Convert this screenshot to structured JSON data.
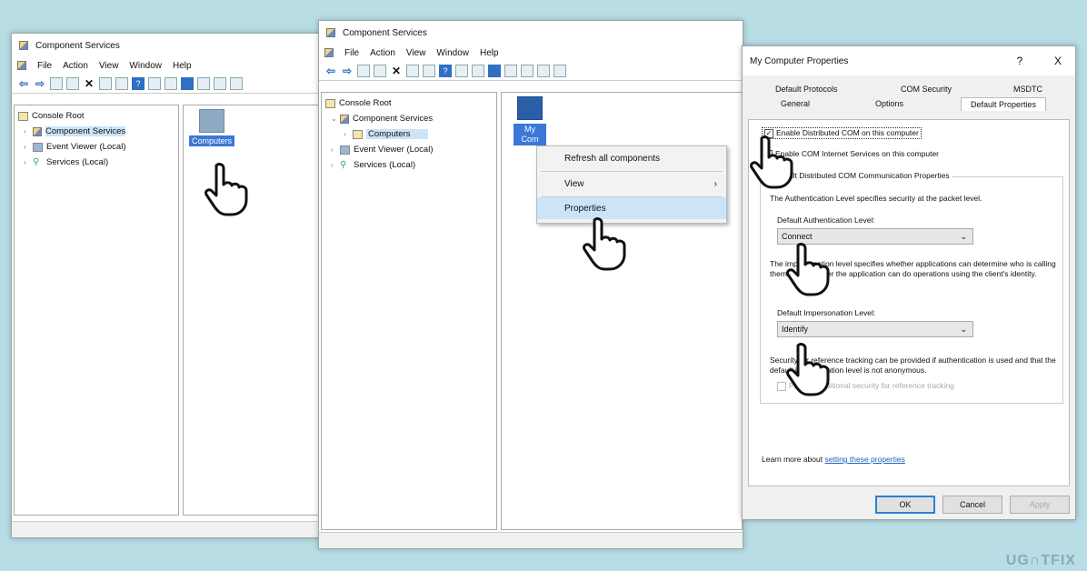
{
  "win1": {
    "title": "Component Services",
    "menu": [
      "File",
      "Action",
      "View",
      "Window",
      "Help"
    ],
    "tree": [
      "Console Root",
      "Component Services",
      "Event Viewer (Local)",
      "Services (Local)"
    ],
    "item_label": "Computers"
  },
  "win2": {
    "title": "Component Services",
    "menu": [
      "File",
      "Action",
      "View",
      "Window",
      "Help"
    ],
    "tree": [
      "Console Root",
      "Component Services",
      "Computers",
      "Event Viewer (Local)",
      "Services (Local)"
    ],
    "item_label_1": "My",
    "item_label_2": "Com",
    "context_menu": [
      "Refresh all components",
      "View",
      "Properties"
    ]
  },
  "dialog": {
    "title": "My Computer Properties",
    "help": "?",
    "close": "X",
    "tabs_row1": [
      "Default Protocols",
      "COM Security",
      "MSDTC"
    ],
    "tabs_row2": [
      "General",
      "Options",
      "Default Properties"
    ],
    "enable_dcom": "Enable Distributed COM on this computer",
    "enable_cis": "Enable COM Internet Services on this computer",
    "group_title": "Default Distributed COM Communication Properties",
    "auth_text": "The Authentication Level specifies security at the packet level.",
    "auth_label": "Default Authentication Level:",
    "auth_value": "Connect",
    "imp_text": "The impersonation level specifies whether applications can determine who is calling them, and whether the application can do operations using the client's identity.",
    "imp_label": "Default Impersonation Level:",
    "imp_value": "Identify",
    "ref_text": "Security for reference tracking can be provided if authentication is used and that the default impersonation level is not anonymous.",
    "ref_check": "Provide additional security for reference tracking",
    "learn_prefix": "Learn more about",
    "learn_link": "setting these properties",
    "ok": "OK",
    "cancel": "Cancel",
    "apply": "Apply"
  },
  "watermark": "UG∩TFIX"
}
